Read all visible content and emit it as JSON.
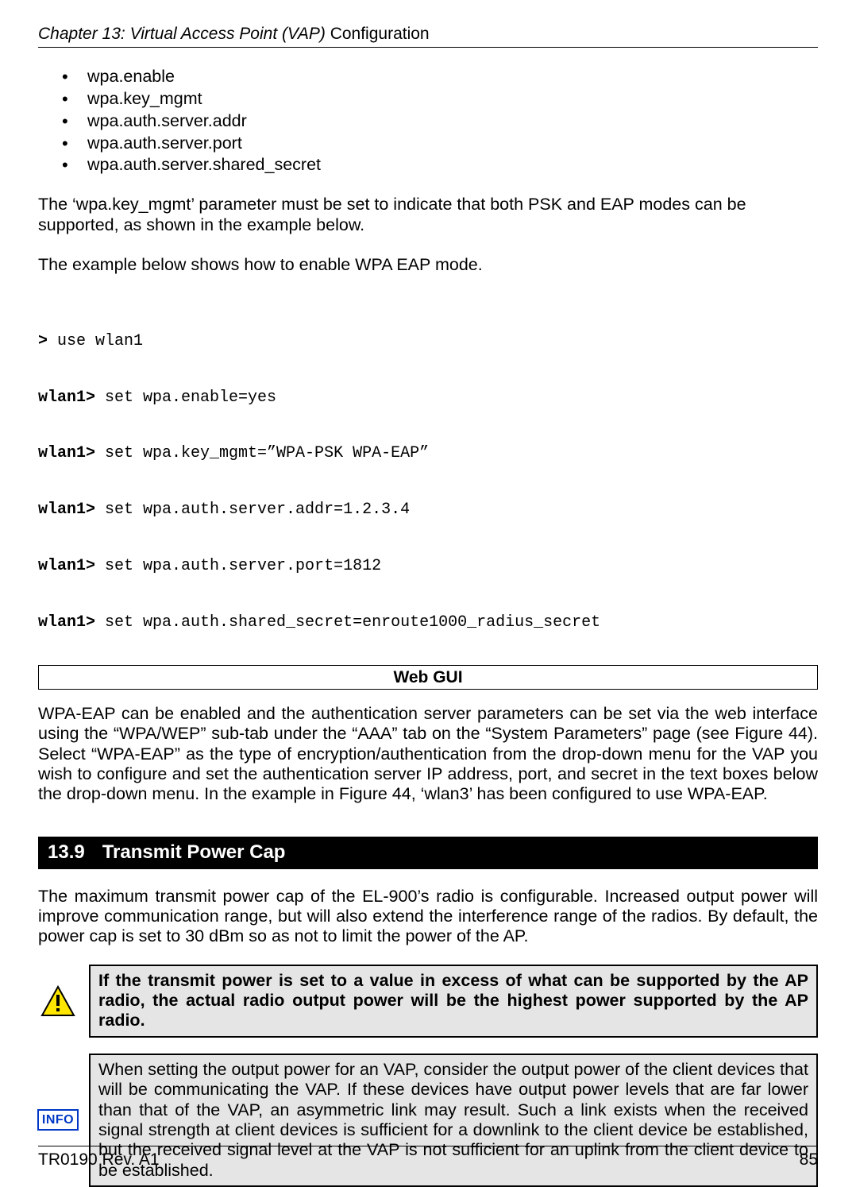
{
  "header": {
    "chapter_italic": "Chapter 13: Virtual Access Point (VAP) ",
    "chapter_rest": "Configuration"
  },
  "bullets": [
    "wpa.enable",
    "wpa.key_mgmt",
    "wpa.auth.server.addr",
    "wpa.auth.server.port",
    "wpa.auth.server.shared_secret"
  ],
  "para1": "The ‘wpa.key_mgmt’ parameter must be set to indicate that both PSK and EAP modes can be supported, as shown in the example below.",
  "para2": "The example below shows how to enable WPA EAP mode.",
  "code": [
    {
      "prompt": ">",
      "cmd": " use wlan1"
    },
    {
      "prompt": "wlan1>",
      "cmd": " set wpa.enable=yes"
    },
    {
      "prompt": "wlan1>",
      "cmd": " set wpa.key_mgmt=”WPA-PSK WPA-EAP”"
    },
    {
      "prompt": "wlan1>",
      "cmd": " set wpa.auth.server.addr=1.2.3.4"
    },
    {
      "prompt": "wlan1>",
      "cmd": " set wpa.auth.server.port=1812"
    },
    {
      "prompt": "wlan1>",
      "cmd": " set wpa.auth.shared_secret=enroute1000_radius_secret"
    }
  ],
  "webgui_label": "Web GUI",
  "webgui_para": "WPA-EAP can be enabled and the authentication server parameters can be set via the web interface using the “WPA/WEP” sub-tab under the “AAA” tab on the “System Parameters” page (see Figure 44). Select “WPA-EAP” as the type of encryption/authentication from the drop-down menu for the VAP you wish to configure and set the authentication server IP address, port, and secret in the text boxes below the drop-down menu. In the example in Figure 44, ‘wlan3’ has been configured to use WPA-EAP.",
  "section": {
    "num": "13.9",
    "title": "Transmit Power Cap"
  },
  "section_para": "The maximum transmit power cap of the EL-900’s radio is configurable. Increased output power will improve communication range, but will also extend the interference range of the radios. By default, the power cap is set to 30 dBm so as not to limit the power of the AP.",
  "warning_box": " If the transmit power is set to a value in excess of what can be supported by the AP radio, the actual radio output power will be the highest power supported by the AP radio.",
  "info_label": "INFO",
  "info_box": "When setting the output power for an VAP, consider the output power of the client devices that will be communicating the VAP. If these devices have output power levels that are far lower than that of the VAP, an asymmetric link may result. Such a link exists when the received signal strength at client devices is sufficient for a downlink to the client device be established, but the received signal level at the VAP is not sufficient for an uplink from the client device to be established.",
  "footer": {
    "left": "TR0190 Rev. A1",
    "right": "85"
  }
}
